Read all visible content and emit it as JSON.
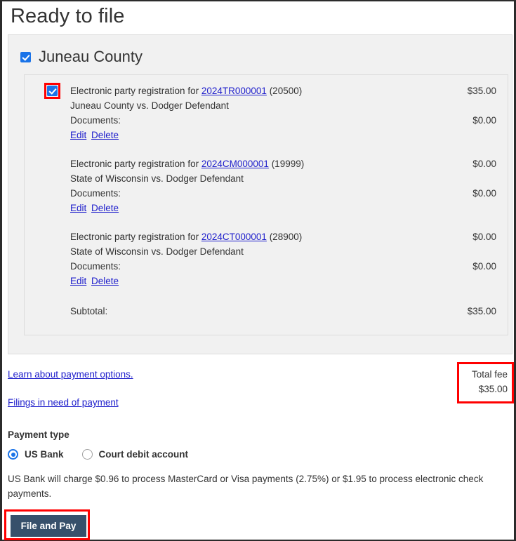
{
  "page": {
    "title": "Ready to file"
  },
  "county": {
    "checkbox_checked": true,
    "name": "Juneau County",
    "filings": [
      {
        "checkbox_checked": true,
        "description_prefix": "Electronic party registration for",
        "case_number": "2024TR000001",
        "case_suffix": "(20500)",
        "amount": "$35.00",
        "parties": "Juneau County vs. Dodger Defendant",
        "documents_label": "Documents:",
        "documents_amount": "$0.00",
        "edit_label": "Edit",
        "delete_label": "Delete"
      },
      {
        "checkbox_checked": false,
        "description_prefix": "Electronic party registration for",
        "case_number": "2024CM000001",
        "case_suffix": "(19999)",
        "amount": "$0.00",
        "parties": "State of Wisconsin vs. Dodger Defendant",
        "documents_label": "Documents:",
        "documents_amount": "$0.00",
        "edit_label": "Edit",
        "delete_label": "Delete"
      },
      {
        "checkbox_checked": false,
        "description_prefix": "Electronic party registration for",
        "case_number": "2024CT000001",
        "case_suffix": "(28900)",
        "amount": "$0.00",
        "parties": "State of Wisconsin vs. Dodger Defendant",
        "documents_label": "Documents:",
        "documents_amount": "$0.00",
        "edit_label": "Edit",
        "delete_label": "Delete"
      }
    ],
    "subtotal_label": "Subtotal:",
    "subtotal_amount": "$35.00"
  },
  "links": {
    "payment_options": "Learn about payment options.",
    "filings_in_need": "Filings in need of payment"
  },
  "total_fee": {
    "label": "Total fee",
    "amount": "$35.00"
  },
  "payment": {
    "type_label": "Payment type",
    "option_us_bank": "US Bank",
    "option_court_debit": "Court debit account",
    "selected": "US Bank",
    "disclaimer": "US Bank will charge $0.96 to process MasterCard or Visa payments (2.75%) or $1.95 to process electronic check payments."
  },
  "actions": {
    "file_and_pay": "File and Pay"
  },
  "colors": {
    "highlight": "#ff0000",
    "accent_blue": "#1a73e8",
    "link_blue": "#2020cc",
    "button_bg": "#37506b",
    "panel_bg": "#f1f1f1"
  }
}
